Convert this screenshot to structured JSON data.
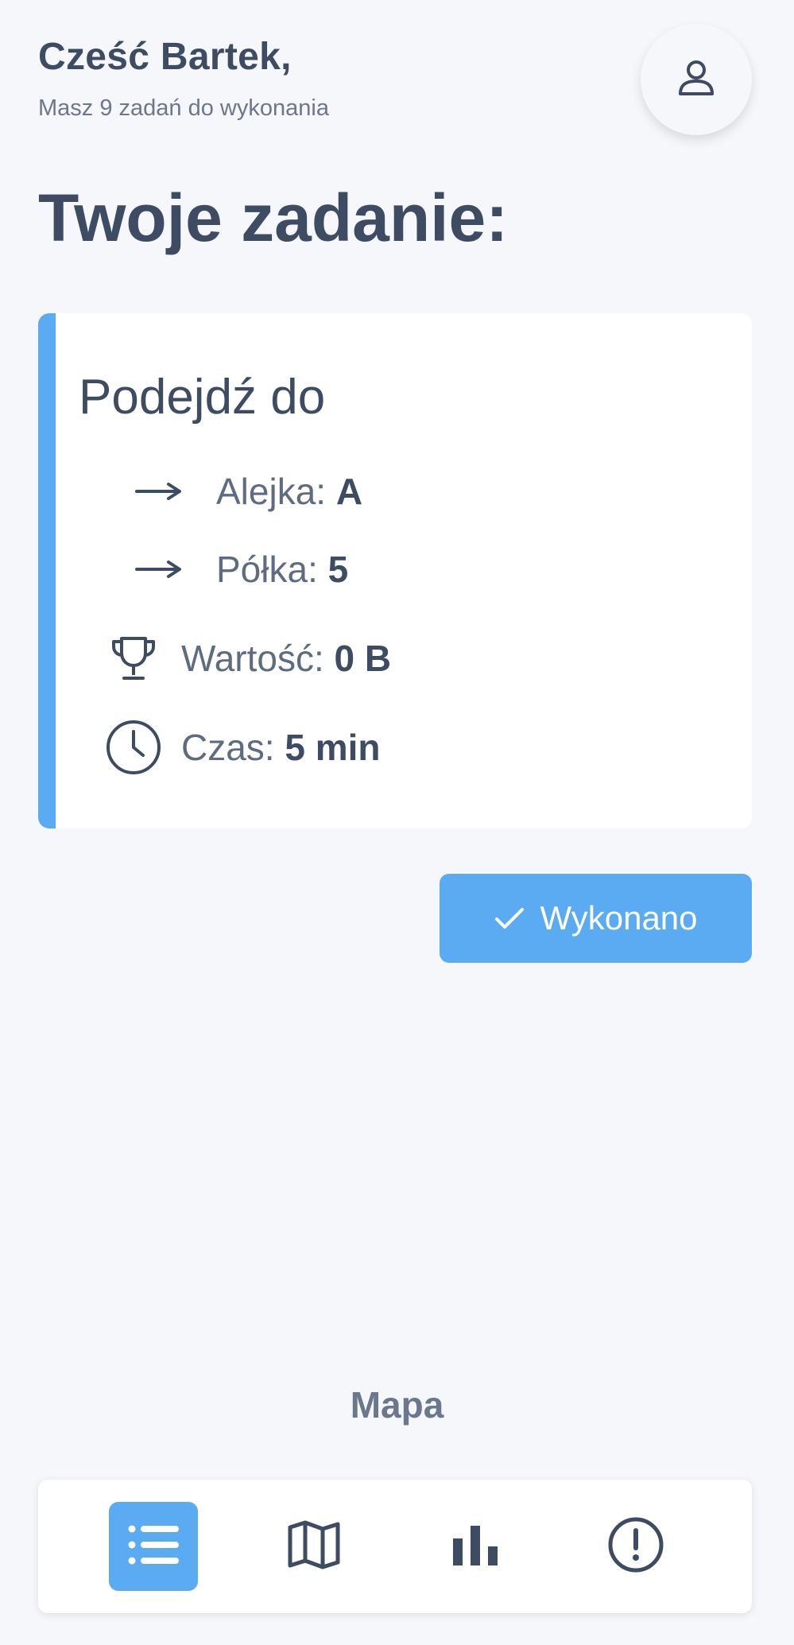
{
  "header": {
    "greeting": "Cześć Bartek,",
    "subtitle": "Masz 9 zadań do wykonania",
    "profile_icon": "user-icon"
  },
  "page_title": "Twoje zadanie:",
  "task": {
    "heading": "Podejdź do",
    "aisle_label": "Alejka:",
    "aisle_value": "A",
    "shelf_label": "Półka:",
    "shelf_value": "5",
    "value_label": "Wartość:",
    "value_value": "0 B",
    "time_label": "Czas:",
    "time_value": "5 min"
  },
  "done_button": {
    "label": "Wykonano"
  },
  "map_label": "Mapa",
  "bottom_nav": {
    "items": [
      {
        "icon": "list-icon",
        "active": true
      },
      {
        "icon": "map-icon",
        "active": false
      },
      {
        "icon": "bar-chart-icon",
        "active": false
      },
      {
        "icon": "alert-icon",
        "active": false
      }
    ]
  },
  "colors": {
    "accent": "#5aabf1",
    "text_dark": "#3e4c63",
    "text_muted": "#6b778c",
    "background": "#f5f7fa"
  }
}
